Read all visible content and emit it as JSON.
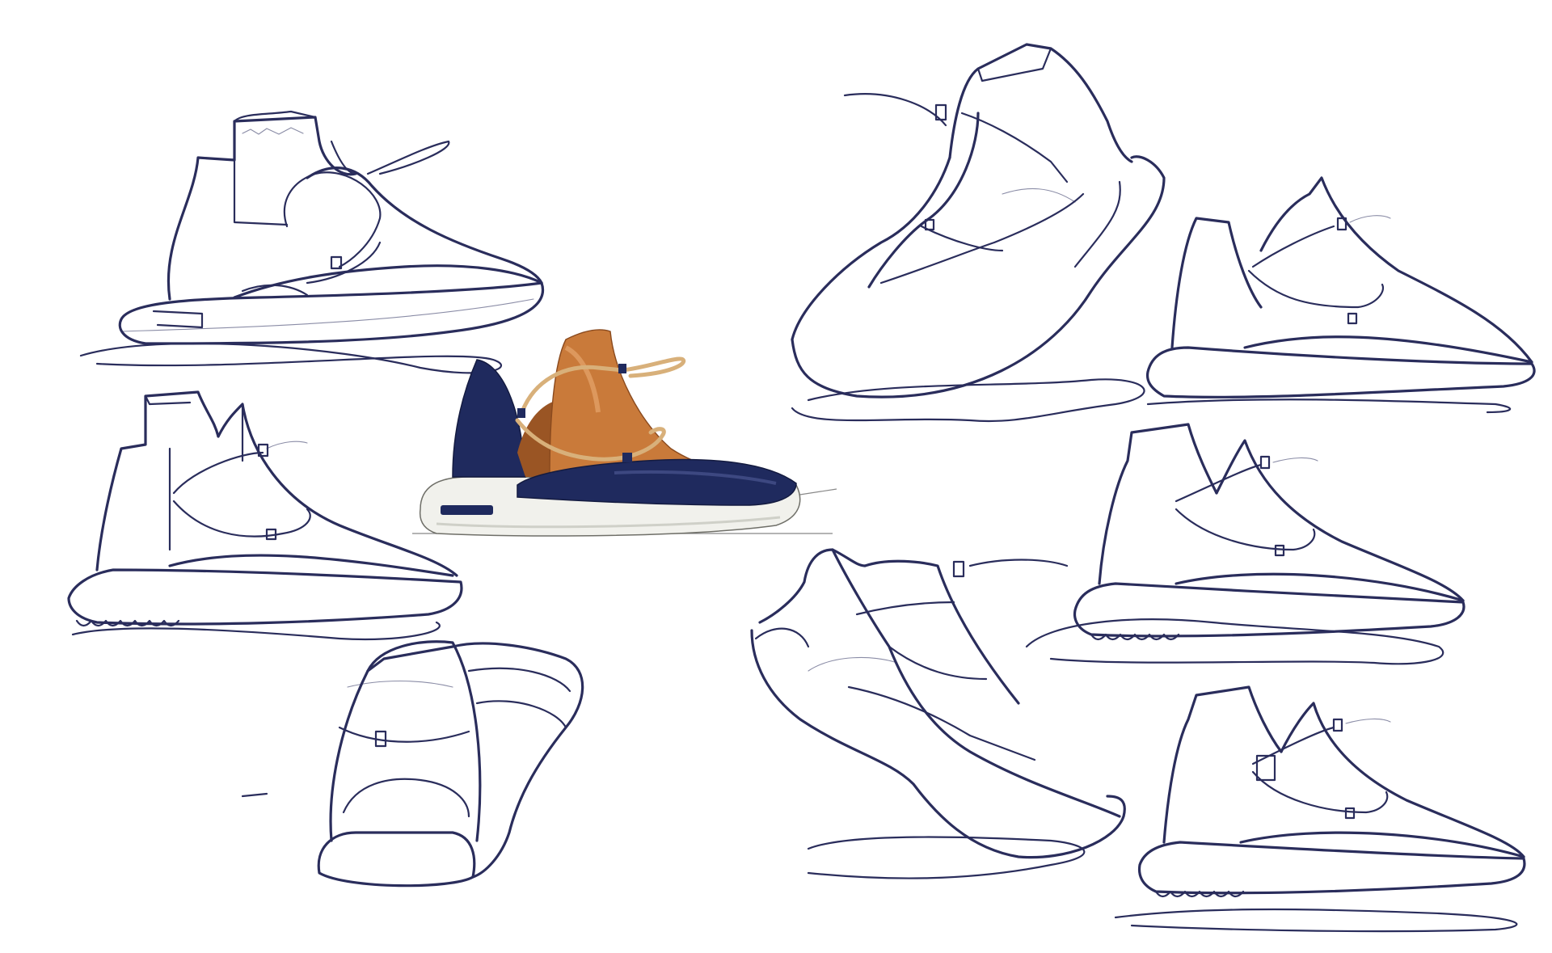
{
  "scene": {
    "subject": "shoe-design-sketch-sheet",
    "sketch_count": 10,
    "colors": {
      "background": "#ffffff",
      "ink": "#2a2d5c",
      "ink_light": "#7a7fa8",
      "navy": "#1f2a5e",
      "tan": "#c97a3a",
      "tan_dark": "#9a5524",
      "sole_white": "#f1f1ec",
      "sole_shadow": "#cfd0c8",
      "cord": "#d8b07a"
    }
  }
}
